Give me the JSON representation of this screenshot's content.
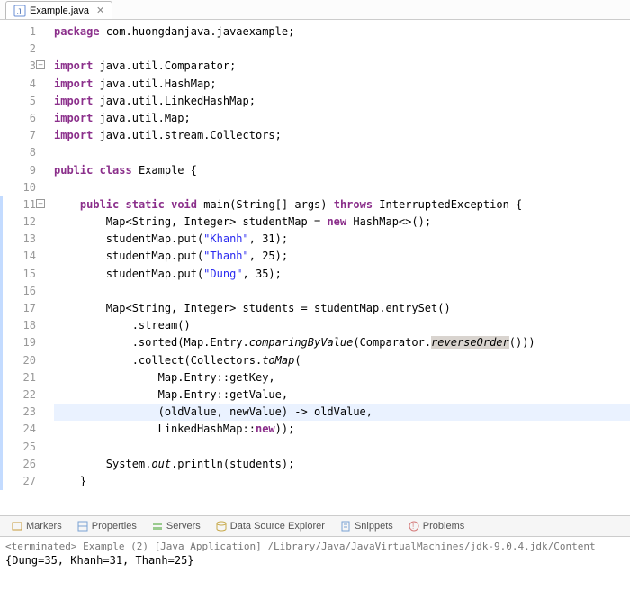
{
  "tab": {
    "filename": "Example.java"
  },
  "lines": [
    {
      "n": 1,
      "html": "<span class='kw'>package</span> com.huongdanjava.javaexample;"
    },
    {
      "n": 2,
      "html": ""
    },
    {
      "n": 3,
      "fold": true,
      "html": "<span class='kw'>import</span> java.util.Comparator;"
    },
    {
      "n": 4,
      "html": "<span class='kw'>import</span> java.util.HashMap;"
    },
    {
      "n": 5,
      "html": "<span class='kw'>import</span> java.util.LinkedHashMap;"
    },
    {
      "n": 6,
      "html": "<span class='kw'>import</span> java.util.Map;"
    },
    {
      "n": 7,
      "html": "<span class='kw'>import</span> java.util.stream.Collectors;"
    },
    {
      "n": 8,
      "html": ""
    },
    {
      "n": 9,
      "html": "<span class='kw'>public</span> <span class='kw'>class</span> Example {"
    },
    {
      "n": 10,
      "html": ""
    },
    {
      "n": 11,
      "fold": true,
      "blue": true,
      "html": "    <span class='kw'>public</span> <span class='kw'>static</span> <span class='kw'>void</span> main(String[] args) <span class='kw'>throws</span> InterruptedException {"
    },
    {
      "n": 12,
      "blue": true,
      "html": "        Map&lt;String, Integer&gt; studentMap = <span class='kw'>new</span> HashMap&lt;&gt;();"
    },
    {
      "n": 13,
      "blue": true,
      "html": "        studentMap.put(<span class='str'>\"Khanh\"</span>, 31);"
    },
    {
      "n": 14,
      "blue": true,
      "html": "        studentMap.put(<span class='str'>\"Thanh\"</span>, 25);"
    },
    {
      "n": 15,
      "blue": true,
      "html": "        studentMap.put(<span class='str'>\"Dung\"</span>, 35);"
    },
    {
      "n": 16,
      "blue": true,
      "html": ""
    },
    {
      "n": 17,
      "blue": true,
      "html": "        Map&lt;String, Integer&gt; students = studentMap.entrySet()"
    },
    {
      "n": 18,
      "blue": true,
      "html": "            .stream()"
    },
    {
      "n": 19,
      "blue": true,
      "html": "            .sorted(Map.Entry.<span class='stat'>comparingByValue</span>(Comparator.<span class='stat selbg'>reverseOrder</span>()))"
    },
    {
      "n": 20,
      "blue": true,
      "html": "            .collect(Collectors.<span class='stat'>toMap</span>("
    },
    {
      "n": 21,
      "blue": true,
      "html": "                Map.Entry::getKey,"
    },
    {
      "n": 22,
      "blue": true,
      "html": "                Map.Entry::getValue,"
    },
    {
      "n": 23,
      "blue": true,
      "hl": true,
      "html": "                (oldValue, newValue) -&gt; oldValue,<span class='cursor'></span>"
    },
    {
      "n": 24,
      "blue": true,
      "html": "                LinkedHashMap::<span class='kw'>new</span>));"
    },
    {
      "n": 25,
      "blue": true,
      "html": ""
    },
    {
      "n": 26,
      "blue": true,
      "html": "        System.<span class='stat'>out</span>.println(students);"
    },
    {
      "n": 27,
      "blue": true,
      "html": "    }"
    }
  ],
  "panelTabs": [
    "Markers",
    "Properties",
    "Servers",
    "Data Source Explorer",
    "Snippets",
    "Problems"
  ],
  "console": {
    "status": "<terminated> Example (2) [Java Application] /Library/Java/JavaVirtualMachines/jdk-9.0.4.jdk/Content",
    "output": "{Dung=35, Khanh=31, Thanh=25}"
  }
}
